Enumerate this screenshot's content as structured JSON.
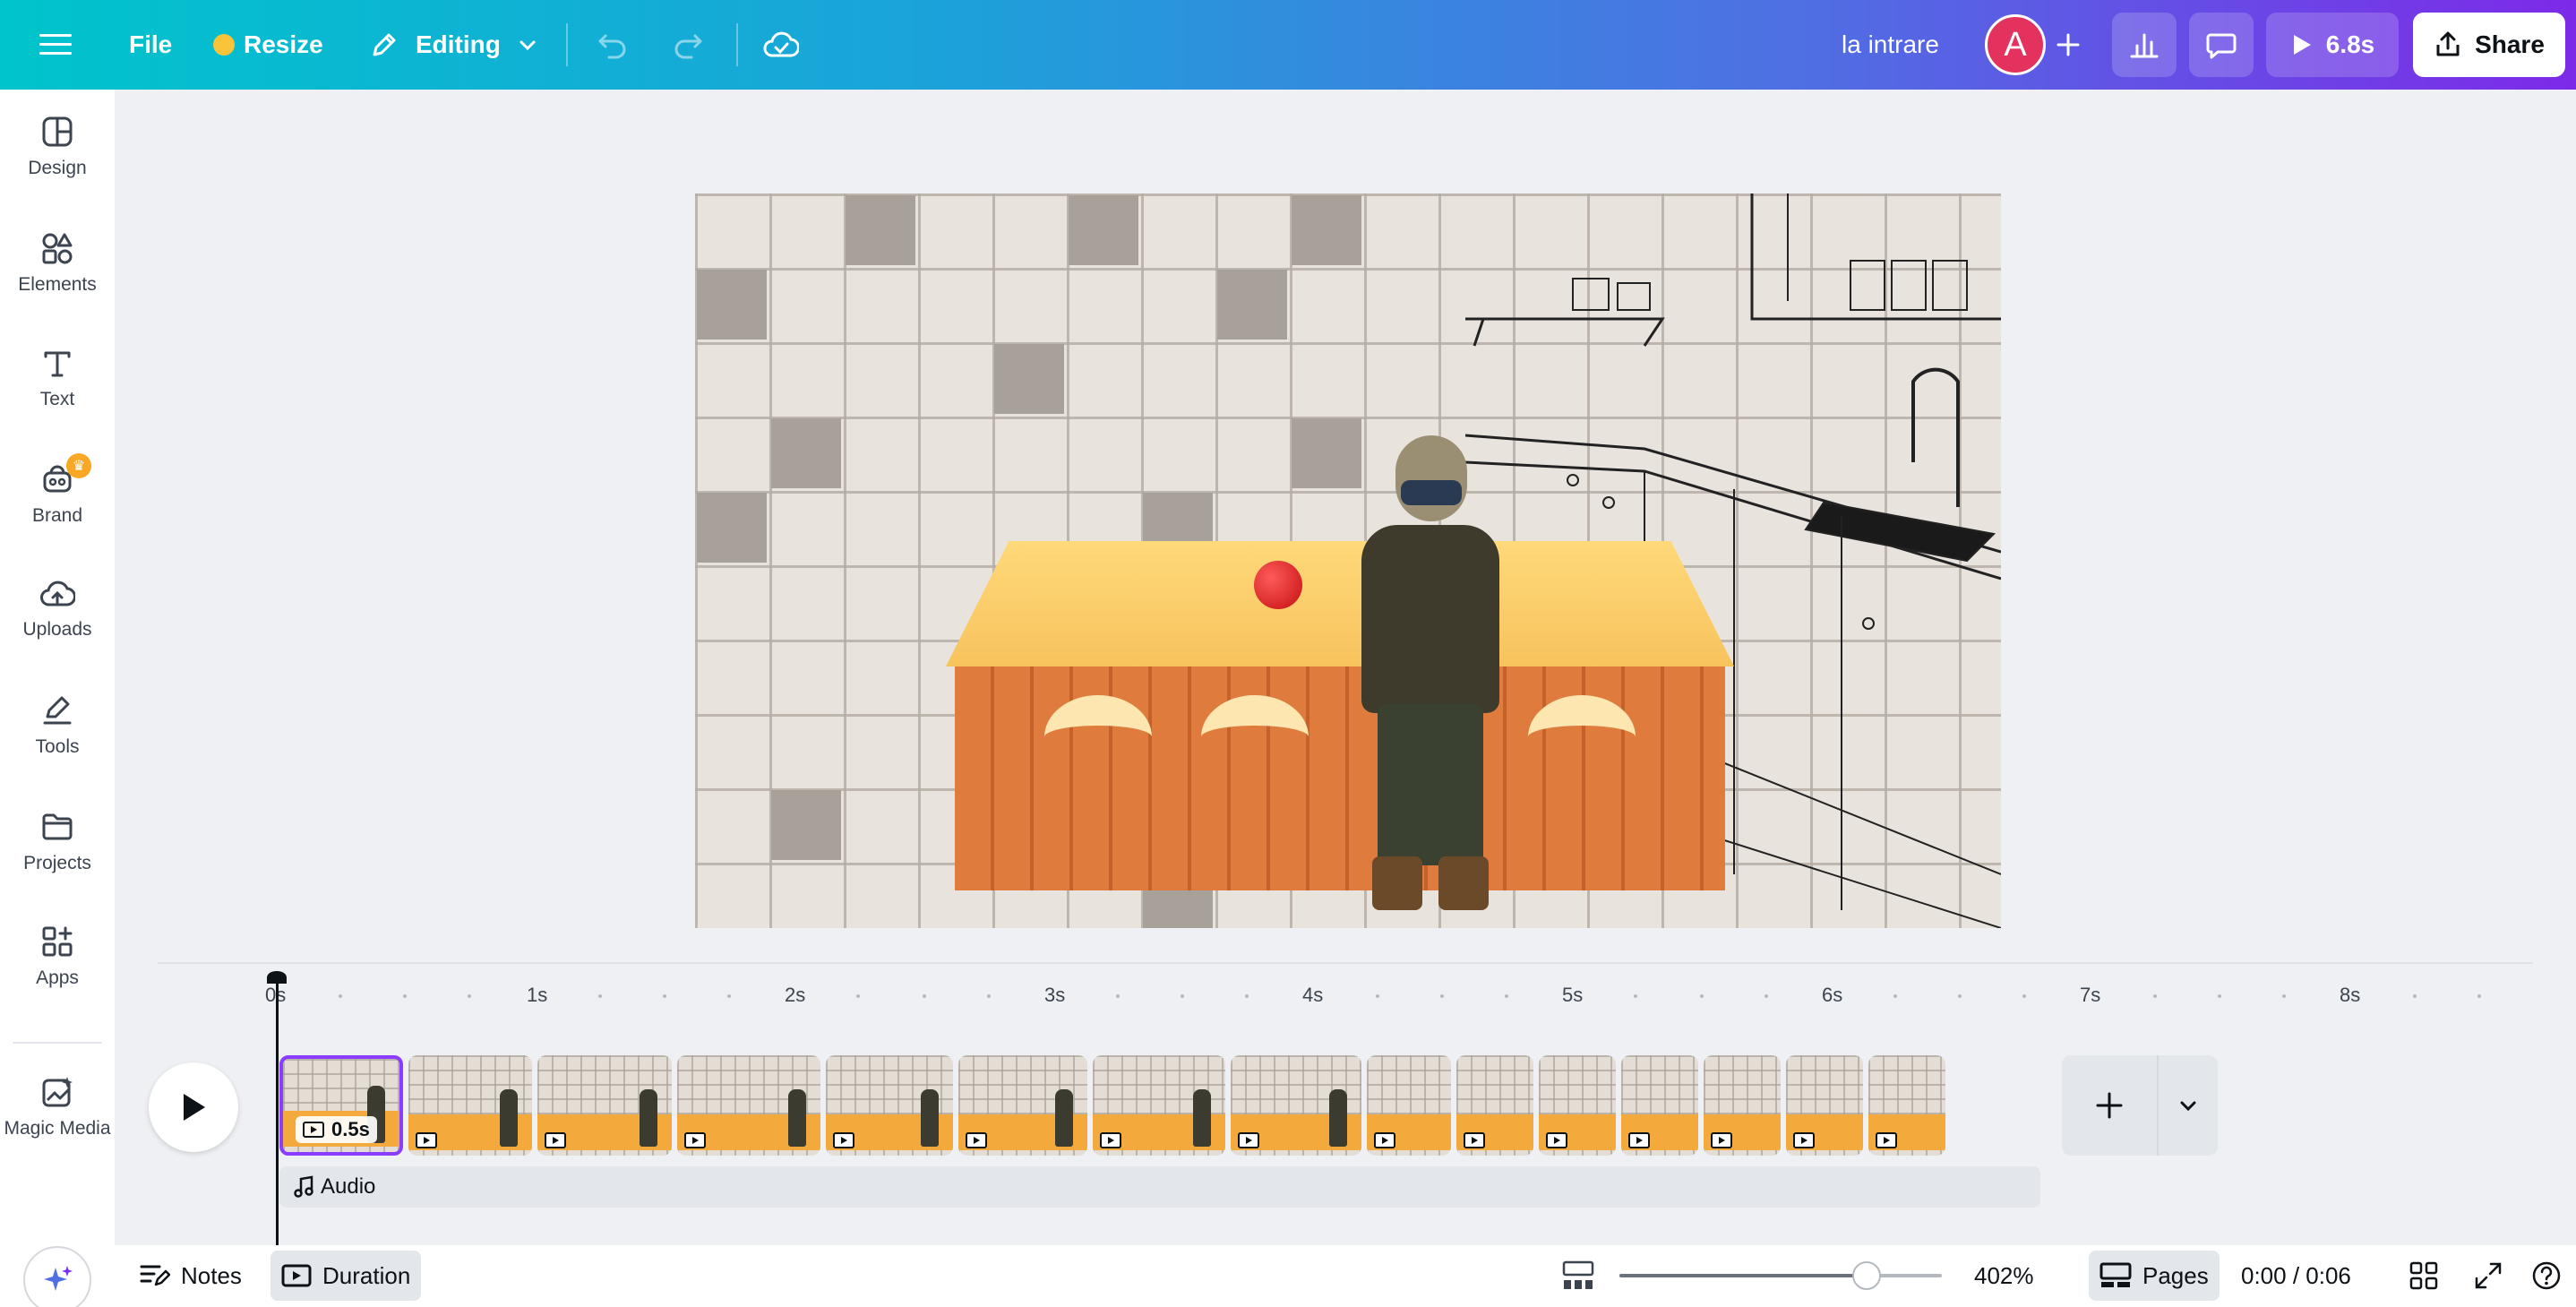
{
  "topbar": {
    "file_label": "File",
    "resize_label": "Resize",
    "editing_label": "Editing",
    "project_title": "la intrare",
    "avatar_initial": "A",
    "play_duration": "6.8s",
    "share_label": "Share"
  },
  "sidebar": {
    "items": [
      {
        "label": "Design",
        "icon": "design-icon"
      },
      {
        "label": "Elements",
        "icon": "elements-icon"
      },
      {
        "label": "Text",
        "icon": "text-icon"
      },
      {
        "label": "Brand",
        "icon": "brand-icon"
      },
      {
        "label": "Uploads",
        "icon": "uploads-icon"
      },
      {
        "label": "Tools",
        "icon": "tools-icon"
      },
      {
        "label": "Projects",
        "icon": "projects-icon"
      },
      {
        "label": "Apps",
        "icon": "apps-icon"
      },
      {
        "label": "Magic Media",
        "icon": "magic-media-icon"
      }
    ]
  },
  "timeline": {
    "ticks": [
      "0s",
      "1s",
      "2s",
      "3s",
      "4s",
      "5s",
      "6s",
      "7s",
      "8s"
    ],
    "first_page_duration": "0.5s",
    "audio_label": "Audio"
  },
  "bottombar": {
    "notes_label": "Notes",
    "duration_label": "Duration",
    "zoom_level": "402%",
    "pages_label": "Pages",
    "time_readout": "0:00 / 0:06"
  },
  "colors": {
    "accent": "#8b3dff",
    "avatar": "#e3325e",
    "brand_gradient_start": "#00c4cc",
    "brand_gradient_end": "#7d2ae8"
  }
}
